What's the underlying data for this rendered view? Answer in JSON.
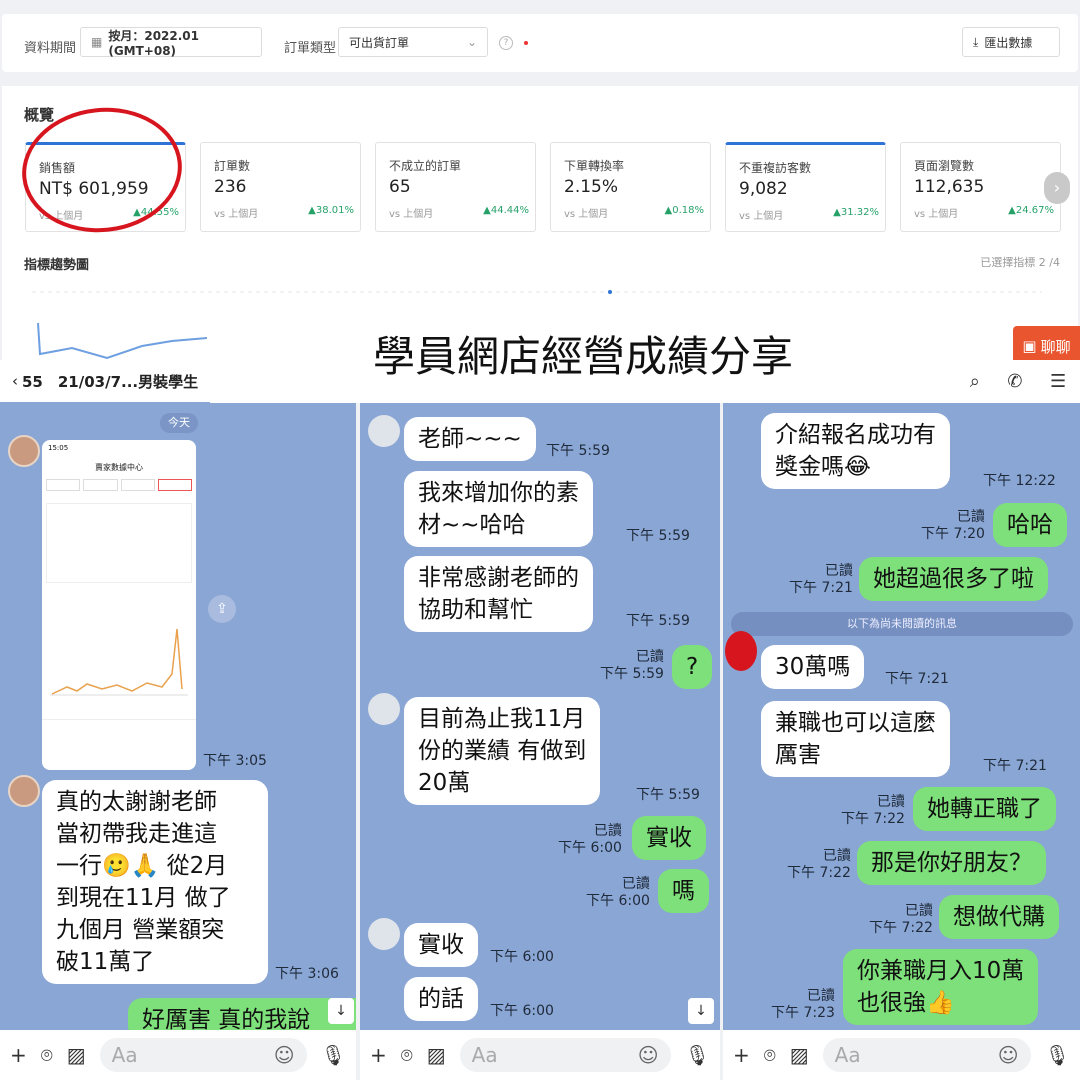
{
  "dashboard": {
    "period_label": "資料期間",
    "period_value": "按月：2022.01 (GMT+08)",
    "order_type_label": "訂單類型",
    "order_type_value": "可出貨訂單",
    "export": "匯出數據",
    "overview_title": "概覽",
    "cards": [
      {
        "label": "銷售額",
        "value": "NT$ 601,959",
        "vs": "vs 上個月",
        "pct": "▲44.55%"
      },
      {
        "label": "訂單數",
        "value": "236",
        "vs": "vs 上個月",
        "pct": "▲38.01%"
      },
      {
        "label": "不成立的訂單",
        "value": "65",
        "vs": "vs 上個月",
        "pct": "▲44.44%"
      },
      {
        "label": "下單轉換率",
        "value": "2.15%",
        "vs": "vs 上個月",
        "pct": "▲0.18%"
      },
      {
        "label": "不重複訪客數",
        "value": "9,082",
        "vs": "vs 上個月",
        "pct": "▲31.32%"
      },
      {
        "label": "頁面瀏覽數",
        "value": "112,635",
        "vs": "vs 上個月",
        "pct": "▲24.67%"
      }
    ],
    "trend_title": "指標趨勢圖",
    "selected": "已選擇指標 2 /4",
    "chat_button": "聊聊"
  },
  "banner": "學員網店經營成績分享",
  "chat1": {
    "header": "55　21/03/7...男裝學生",
    "today": "今天",
    "phone_title": "賣家數據中心",
    "time1": "下午 3:05",
    "msg": "真的太謝謝老師\n當初帶我走進這\n一行🥲🙏 從2月\n到現在11月 做了\n九個月 營業額突\n破11萬了",
    "time2": "下午 3:06",
    "reply": "好厲害 真的我說",
    "input_placeholder": "Aa"
  },
  "chat2": {
    "m1": "老師~~~",
    "t1": "下午 5:59",
    "m2": "我來增加你的素\n材~~哈哈",
    "t2": "下午 5:59",
    "m3": "非常感謝老師的\n協助和幫忙",
    "t3": "下午 5:59",
    "r1_read": "已讀",
    "r1_time": "下午 5:59",
    "r1": "?",
    "m4": "目前為止我11月\n份的業績 有做到\n20萬",
    "t4": "下午 5:59",
    "r2_read": "已讀",
    "r2_time": "下午 6:00",
    "r2": "實收",
    "r3_read": "已讀",
    "r3_time": "下午 6:00",
    "r3": "嗎",
    "m5": "實收",
    "t5": "下午 6:00",
    "m6": "的話",
    "t6": "下午 6:00",
    "input_placeholder": "Aa"
  },
  "chat3": {
    "m1": "介紹報名成功有\n獎金嗎😂",
    "t1": "下午 12:22",
    "r1_read": "已讀",
    "r1_time": "下午 7:20",
    "r1": "哈哈",
    "r2_read": "已讀",
    "r2_time": "下午 7:21",
    "r2": "她超過很多了啦",
    "unread": "以下為尚未閱讀的訊息",
    "m2": "30萬嗎",
    "t2": "下午 7:21",
    "m3": "兼職也可以這麼\n厲害",
    "t3": "下午 7:21",
    "r3_read": "已讀",
    "r3_time": "下午 7:22",
    "r3": "她轉正職了",
    "r4_read": "已讀",
    "r4_time": "下午 7:22",
    "r4": "那是你好朋友？",
    "r5_read": "已讀",
    "r5_time": "下午 7:22",
    "r5": "想做代購",
    "r6_read": "已讀",
    "r6_time": "下午 7:23",
    "r6": "你兼職月入10萬\n也很強👍",
    "input_placeholder": "Aa"
  }
}
